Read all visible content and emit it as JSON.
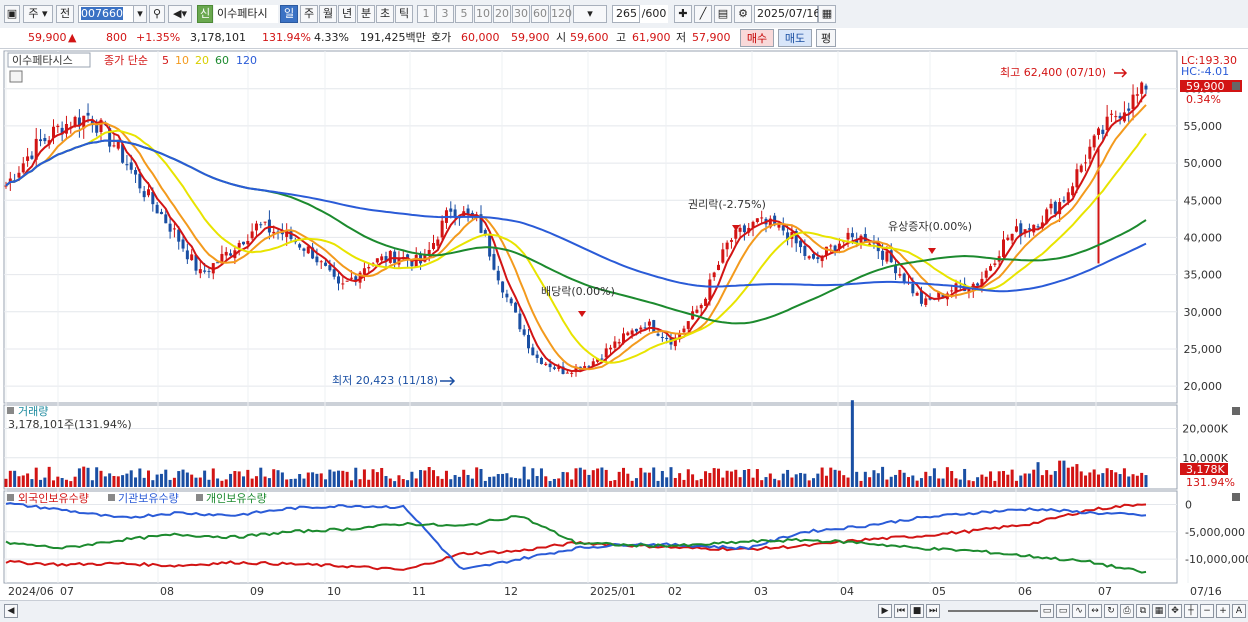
{
  "toolbar": {
    "menu_icon": "window-menu-icon",
    "type_label": "주",
    "scope_label": "전",
    "code_value": "007660",
    "search_icon": "search-icon",
    "sound_icon": "speaker-icon",
    "new_badge": "신",
    "stock_name": "이수페타시",
    "period_tabs": [
      "일",
      "주",
      "월",
      "년",
      "분",
      "초",
      "틱"
    ],
    "active_period": "일",
    "interval_buttons": [
      "1",
      "3",
      "5",
      "10",
      "20",
      "30",
      "60",
      "120"
    ],
    "count_value": "265",
    "count_total": "/600",
    "date_value": "2025/07/16"
  },
  "info": {
    "price": "59,900",
    "change": "800",
    "change_pct": "+1.35%",
    "volume": "3,178,101",
    "volume_pct": "131.94%",
    "turnover_pct": "4.33%",
    "amount": "191,425백만",
    "quote_label": "호가",
    "ask": "60,000",
    "bid": "59,900",
    "open_label": "시",
    "open": "59,600",
    "high_label": "고",
    "high": "61,900",
    "low_label": "저",
    "low": "57,900",
    "buy_label": "매수",
    "sell_label": "매도",
    "eval_label": "평"
  },
  "price_panel": {
    "name_tag": "이수페타시스",
    "ma_label": "종가 단순",
    "ma_periods": [
      "5",
      "10",
      "20",
      "60",
      "120"
    ],
    "ma_colors": [
      "#d21414",
      "#f39a1d",
      "#e8e400",
      "#1c8a2e",
      "#2a5bd7"
    ],
    "lc": "LC:193.30",
    "hc": "HC:-4.01",
    "last_price": "59,900",
    "last_pct": "0.34%",
    "high_note": "최고 62,400 (07/10)",
    "low_note": "최저 20,423 (11/18)",
    "event_dividend": "배당락(0.00%)",
    "event_rights": "권리락(-2.75%)",
    "event_capital": "유상증자(0.00%)",
    "y_ticks": [
      "60,000",
      "55,000",
      "50,000",
      "45,000",
      "40,000",
      "35,000",
      "30,000",
      "25,000",
      "20,000"
    ]
  },
  "volume_panel": {
    "title": "거래량",
    "current": "3,178,101주(131.94%)",
    "y_ticks": [
      "20,000K",
      "10,000K"
    ],
    "last_value": "3,178K",
    "last_pct": "131.94%"
  },
  "holding_panel": {
    "titles": [
      "외국인보유수량",
      "기관보유수량",
      "개인보유수량"
    ],
    "title_colors": [
      "#d21414",
      "#2a5bd7",
      "#1c8a2e"
    ],
    "y_ticks": [
      "0",
      "-5,000,000",
      "-10,000,000"
    ]
  },
  "x_axis": {
    "labels": [
      "2024/06",
      "07",
      "08",
      "09",
      "10",
      "11",
      "12",
      "2025/01",
      "02",
      "03",
      "04",
      "05",
      "06",
      "07",
      "07/16"
    ]
  },
  "chart_data": [
    {
      "type": "candlestick",
      "title": "이수페타시스",
      "ylim": [
        18000,
        64000
      ],
      "x_range": [
        "2024/06",
        "2025/07/16"
      ],
      "close_path": [
        47000,
        52000,
        55000,
        56500,
        52000,
        46000,
        41000,
        35000,
        38000,
        41500,
        40500,
        38000,
        33000,
        36500,
        37500,
        36500,
        44000,
        42000,
        32000,
        24000,
        22000,
        23000,
        26000,
        28500,
        26000,
        31000,
        39500,
        42000,
        41000,
        36500,
        39500,
        40000,
        36000,
        31000,
        33000,
        34000,
        40000,
        42000,
        45000,
        52000,
        57000,
        59900
      ],
      "series": [
        {
          "name": "5",
          "color": "#d21414"
        },
        {
          "name": "10",
          "color": "#f39a1d"
        },
        {
          "name": "20",
          "color": "#e8e400"
        },
        {
          "name": "60",
          "color": "#1c8a2e"
        },
        {
          "name": "120",
          "color": "#2a5bd7"
        }
      ],
      "annotations": [
        "최고 62,400 (07/10)",
        "최저 20,423 (11/18)",
        "배당락(0.00%)",
        "권리락(-2.75%)",
        "유상증자(0.00%)"
      ]
    },
    {
      "type": "bar",
      "title": "거래량",
      "ylim": [
        0,
        26000
      ],
      "last": 3178
    },
    {
      "type": "line",
      "series": [
        {
          "name": "외국인보유수량",
          "color": "#d21414"
        },
        {
          "name": "기관보유수량",
          "color": "#2a5bd7"
        },
        {
          "name": "개인보유수량",
          "color": "#1c8a2e"
        }
      ],
      "ylim": [
        -14000000,
        1000000
      ]
    }
  ]
}
